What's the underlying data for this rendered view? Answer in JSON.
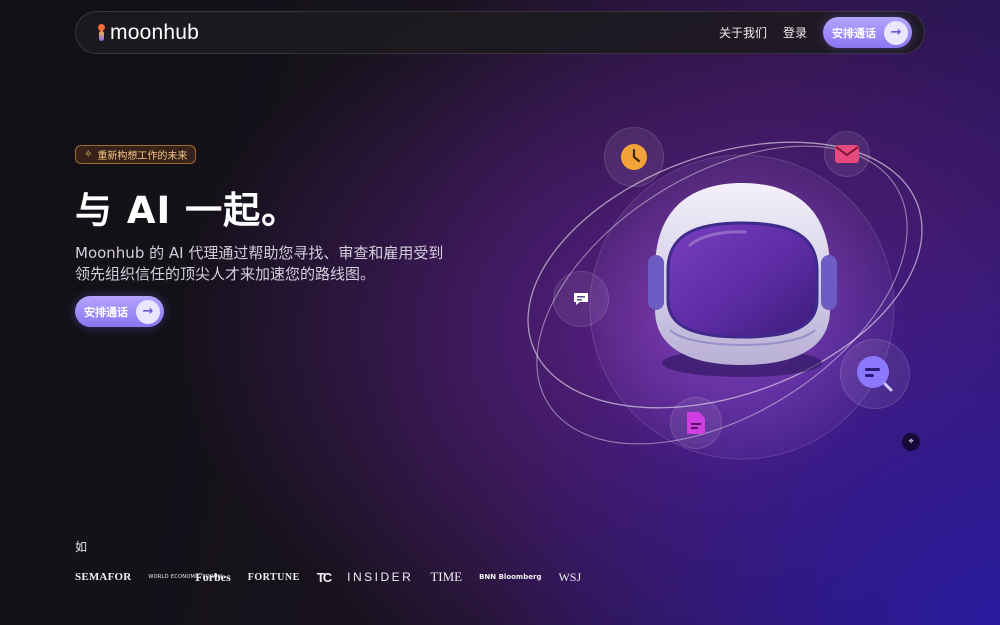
{
  "nav": {
    "logo_text": "moonhub",
    "about_label": "关于我们",
    "login_label": "登录",
    "cta_label": "安排通话",
    "cta_arrow": "→"
  },
  "hero": {
    "badge_icon": "sparkle-icon",
    "badge_text": "重新构想工作的未来",
    "title": "与 AI 一起。",
    "description": "Moonhub 的 AI 代理通过帮助您寻找、审查和雇用受到领先组织信任的顶尖人才来加速您的路线图。",
    "cta_label": "安排通话",
    "cta_arrow": "→"
  },
  "illustration": {
    "icons": [
      "clock-icon",
      "mail-icon",
      "chat-icon",
      "search-icon",
      "document-icon"
    ],
    "colors": {
      "clock": "#f3a23a",
      "mail": "#e8497c",
      "chat": "#ffffff",
      "search": "#8b78ff",
      "document": "#d03fe0"
    }
  },
  "partners": {
    "heading": "如",
    "logos": {
      "semafor": "SEMAFOR",
      "wef": "WORLD ECONOMIC FORUM",
      "forbes": "Forbes",
      "fortune": "FORTUNE",
      "techcrunch": "TC",
      "insider": "INSIDER",
      "time": "TIME",
      "bnn": "BNN Bloomberg",
      "wsj": "WSJ"
    }
  }
}
